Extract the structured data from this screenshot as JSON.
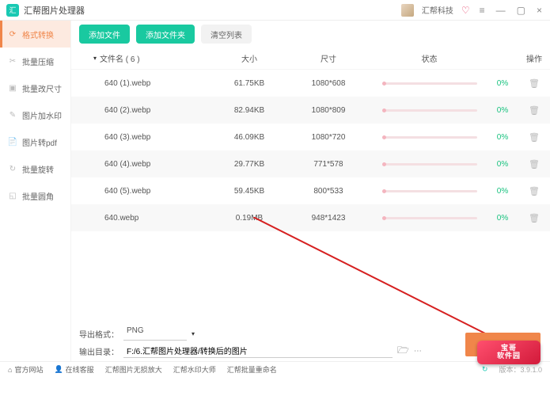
{
  "titlebar": {
    "title": "汇帮图片处理器",
    "brand": "汇帮科技"
  },
  "window": {
    "menu": "≡",
    "min": "—",
    "max": "▢",
    "close": "×"
  },
  "sidebar": {
    "items": [
      {
        "label": "格式转换",
        "icon": "⟳"
      },
      {
        "label": "批量压缩",
        "icon": "✂"
      },
      {
        "label": "批量改尺寸",
        "icon": "▣"
      },
      {
        "label": "图片加水印",
        "icon": "✎"
      },
      {
        "label": "图片转pdf",
        "icon": "📄"
      },
      {
        "label": "批量旋转",
        "icon": "↻"
      },
      {
        "label": "批量圆角",
        "icon": "◱"
      }
    ]
  },
  "toolbar": {
    "add_file": "添加文件",
    "add_folder": "添加文件夹",
    "clear": "清空列表"
  },
  "table": {
    "header": {
      "name": "文件名 ( 6 )",
      "size": "大小",
      "dim": "尺寸",
      "status": "状态",
      "op": "操作"
    },
    "rows": [
      {
        "name": "640 (1).webp",
        "size": "61.75KB",
        "dim": "1080*608",
        "pct": "0%"
      },
      {
        "name": "640 (2).webp",
        "size": "82.94KB",
        "dim": "1080*809",
        "pct": "0%"
      },
      {
        "name": "640 (3).webp",
        "size": "46.09KB",
        "dim": "1080*720",
        "pct": "0%"
      },
      {
        "name": "640 (4).webp",
        "size": "29.77KB",
        "dim": "771*578",
        "pct": "0%"
      },
      {
        "name": "640 (5).webp",
        "size": "59.45KB",
        "dim": "800*533",
        "pct": "0%"
      },
      {
        "name": "640.webp",
        "size": "0.19MB",
        "dim": "948*1423",
        "pct": "0%"
      }
    ]
  },
  "bottom": {
    "format_label": "导出格式：",
    "format_value": "PNG",
    "path_label": "输出目录：",
    "path_value": "F:/6.汇帮图片处理器/转换后的图片"
  },
  "footer": {
    "site": "官方网站",
    "chat": "在线客服",
    "p1": "汇帮图片无损放大",
    "p2": "汇帮水印大师",
    "p3": "汇帮批量重命名",
    "version": "版本：3.9.1.0"
  },
  "badge": {
    "l1": "宝哥",
    "l2": "软件园"
  }
}
